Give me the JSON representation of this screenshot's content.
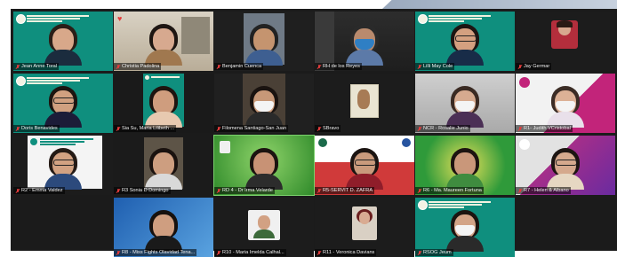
{
  "participants": [
    {
      "name": "Jean Anne Toral",
      "muted": true
    },
    {
      "name": "Christia Padolina",
      "muted": true,
      "reaction": "♥"
    },
    {
      "name": "Benjamin Cuenca",
      "muted": true
    },
    {
      "name": "RH de los Reyes",
      "muted": true
    },
    {
      "name": "Lilli May Cole",
      "muted": true
    },
    {
      "name": "Jay Germar",
      "muted": true
    },
    {
      "name": "Doris Benavides",
      "muted": true
    },
    {
      "name": "Sia Su, Maria Lilibeth ...",
      "muted": true
    },
    {
      "name": "Filomena Santiago-San Juan",
      "muted": true
    },
    {
      "name": "SBravo",
      "muted": true
    },
    {
      "name": "NCR - Rosalie Junio",
      "muted": true
    },
    {
      "name": "R1- Judith VCristobal",
      "muted": true
    },
    {
      "name": "R2 - Emma Valdez",
      "muted": true
    },
    {
      "name": "R3 Sonia D Domingo",
      "muted": true
    },
    {
      "name": "RD 4 - Dr Irma Velarde",
      "muted": true
    },
    {
      "name": "R5-SERVIT D. ZAFRA",
      "muted": true
    },
    {
      "name": "R6 - Ma. Maureen Fortuna",
      "muted": true
    },
    {
      "name": "R7 - Helen & Albano",
      "muted": true
    },
    {
      "name": "R8 - Miss Fights Olavidad Tena...",
      "muted": true
    },
    {
      "name": "R10 - Maria Imelda Calhal...",
      "muted": true
    },
    {
      "name": "R11 - Veronica Davians",
      "muted": true
    },
    {
      "name": "RSOG Jeum",
      "muted": true
    }
  ],
  "colors": {
    "pogs_teal": "#0f8f7e",
    "muted_icon": "#e23c3c",
    "active_speaker": "#7ad16c"
  }
}
